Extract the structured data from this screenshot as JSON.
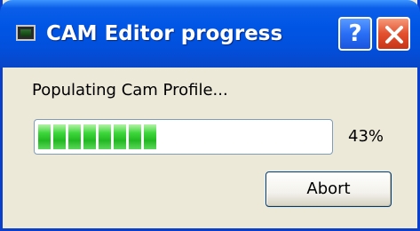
{
  "window": {
    "title": "CAM Editor progress",
    "help_label": "?",
    "close_icon": "close-icon",
    "app_icon": "monitor-icon"
  },
  "dialog": {
    "status_text": "Populating Cam Profile...",
    "progress_percent": 43,
    "progress_label": "43%",
    "progress_color": "#33cc33",
    "abort_label": "Abort"
  }
}
